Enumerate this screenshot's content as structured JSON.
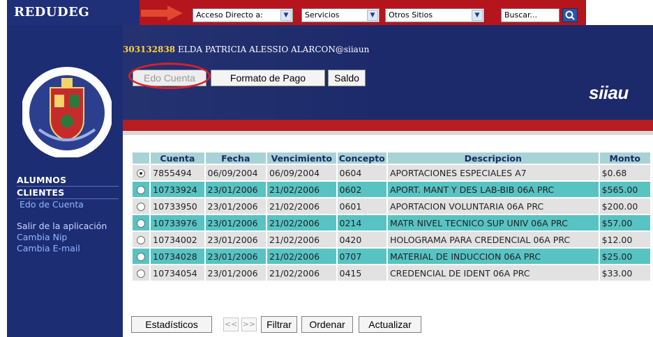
{
  "brand": {
    "name": "REDUDEG"
  },
  "topbar": {
    "dropdowns": [
      {
        "id": "acceso",
        "value": "Acceso Directo a:"
      },
      {
        "id": "servicios",
        "value": "Servicios"
      },
      {
        "id": "otros",
        "value": "Otros Sitios"
      }
    ],
    "search": {
      "value": "Buscar..."
    }
  },
  "sidebar": {
    "sections": [
      {
        "label": "ALUMNOS"
      },
      {
        "label": "CLIENTES"
      }
    ],
    "active_link": "Edo de Cuenta",
    "exit_label": "Salir de la aplicación",
    "links": [
      "Cambia Nip",
      "Cambia E-mail"
    ]
  },
  "header": {
    "user_id": "303132838",
    "user_name": "ELDA PATRICIA ALESSIO ALARCON@siiaun",
    "tabs": [
      {
        "label": "Edo Cuenta",
        "active": true
      },
      {
        "label": "Formato de Pago",
        "active": false
      },
      {
        "label": "Saldo",
        "active": false
      }
    ],
    "logo_text": "siiau"
  },
  "table": {
    "columns": [
      "",
      "Cuenta",
      "Fecha",
      "Vencimiento",
      "Concepto",
      "Descripcion",
      "Monto"
    ],
    "rows": [
      {
        "selected": true,
        "cuenta": "7855494",
        "fecha": "06/09/2004",
        "vencimiento": "06/09/2004",
        "concepto": "0604",
        "descripcion": "APORTACIONES ESPECIALES A7",
        "monto": "$0.68"
      },
      {
        "selected": false,
        "cuenta": "10733924",
        "fecha": "23/01/2006",
        "vencimiento": "21/02/2006",
        "concepto": "0602",
        "descripcion": "APORT. MANT Y DES LAB-BIB 06A PRC",
        "monto": "$565.00"
      },
      {
        "selected": false,
        "cuenta": "10733950",
        "fecha": "23/01/2006",
        "vencimiento": "21/02/2006",
        "concepto": "0601",
        "descripcion": "APORTACION VOLUNTARIA 06A PRC",
        "monto": "$200.00"
      },
      {
        "selected": false,
        "cuenta": "10733976",
        "fecha": "23/01/2006",
        "vencimiento": "21/02/2006",
        "concepto": "0214",
        "descripcion": "MATR NIVEL TECNICO SUP UNIV 06A PRC",
        "monto": "$57.00"
      },
      {
        "selected": false,
        "cuenta": "10734002",
        "fecha": "23/01/2006",
        "vencimiento": "21/02/2006",
        "concepto": "0420",
        "descripcion": "HOLOGRAMA PARA CREDENCIAL 06A PRC",
        "monto": "$12.00"
      },
      {
        "selected": false,
        "cuenta": "10734028",
        "fecha": "23/01/2006",
        "vencimiento": "21/02/2006",
        "concepto": "0707",
        "descripcion": "MATERIAL DE INDUCCION 06A PRC",
        "monto": "$25.00"
      },
      {
        "selected": false,
        "cuenta": "10734054",
        "fecha": "23/01/2006",
        "vencimiento": "21/02/2006",
        "concepto": "0415",
        "descripcion": "CREDENCIAL DE IDENT 06A PRC",
        "monto": "$33.00"
      }
    ]
  },
  "footer": {
    "estadisticos": "Estadísticos",
    "prev": "<<",
    "next": ">>",
    "filtrar": "Filtrar",
    "ordenar": "Ordenar",
    "actualizar": "Actualizar"
  },
  "colors": {
    "navy": "#1d2d73",
    "red": "#b5151d",
    "teal_row": "#58c3c3",
    "gray_row": "#e2e2e2",
    "header_cell": "#a7d3d6",
    "user_id": "#ffd23a",
    "link": "#8fb8ff"
  },
  "icons": [
    "arrow-decoration-icon",
    "chevron-down-icon",
    "search-icon",
    "university-crest-icon",
    "radio-icon"
  ]
}
